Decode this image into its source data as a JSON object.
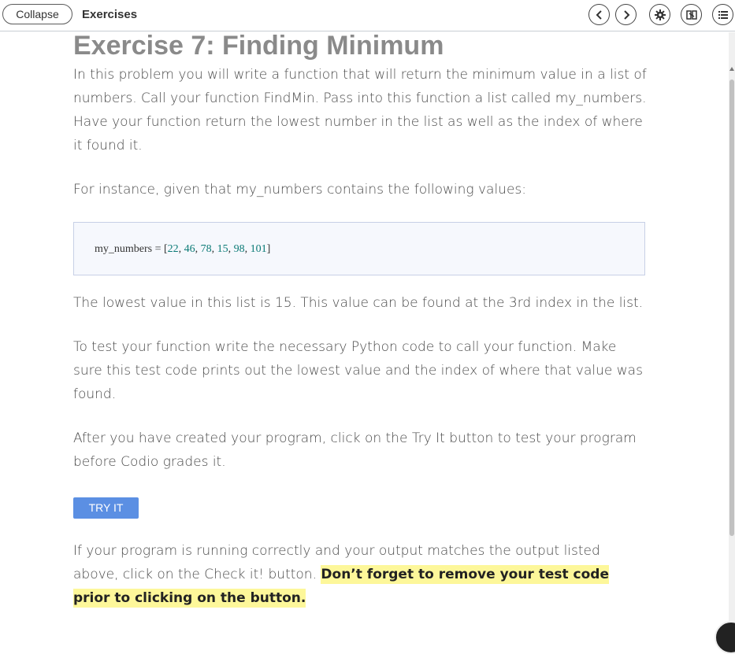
{
  "topbar": {
    "collapse_label": "Collapse",
    "title": "Exercises",
    "icons": [
      "chevron-left-icon",
      "chevron-right-icon",
      "gear-icon",
      "book-icon",
      "list-icon"
    ]
  },
  "exercise": {
    "title": "Exercise 7: Finding Minimum",
    "para1": "In this problem you will write a function that will return the minimum value in a list of numbers. Call your function FindMin. Pass into this function a list called my_numbers. Have your function return the lowest number in the list as well as the index of where it found it.",
    "para2": "For instance, given that my_numbers contains the following values:",
    "code": {
      "prefix": "my_numbers = [",
      "values": [
        "22",
        "46",
        "78",
        "15",
        "98",
        "101"
      ],
      "suffix": "]"
    },
    "para3": "The lowest value in this list is 15. This value can be found at the 3rd index in the list.",
    "para4": "To test your function write the necessary Python code to call your function. Make sure this test code prints out the lowest value and the index of where that value was found.",
    "para5": "After you have created your program, click on the Try It button to test your program before Codio grades it.",
    "try_it_label": "TRY IT",
    "para6_plain": "If your program is running correctly and your output matches the output listed above, click on the Check it! button. ",
    "para6_highlight": "Don’t forget to remove your test code prior to clicking on the button."
  },
  "colors": {
    "accent": "#5b8fe3",
    "highlight": "#fdf79a",
    "code_number": "#0b7a76"
  }
}
